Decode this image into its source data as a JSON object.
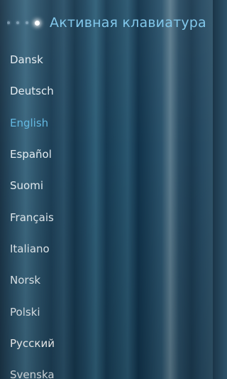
{
  "header": {
    "title": "Активная клавиатура",
    "page_indicator": {
      "total": 4,
      "current": 4
    }
  },
  "languages": [
    {
      "label": "Dansk"
    },
    {
      "label": "Deutsch"
    },
    {
      "label": "English",
      "selected": true
    },
    {
      "label": "Español"
    },
    {
      "label": "Suomi"
    },
    {
      "label": "Français"
    },
    {
      "label": "Italiano"
    },
    {
      "label": "Norsk"
    },
    {
      "label": "Polski"
    },
    {
      "label": "Русский"
    },
    {
      "label": "Svenska"
    }
  ],
  "colors": {
    "accent": "#7ec6ea",
    "selected_text": "#62b8e2",
    "text": "#e4ecf1"
  }
}
